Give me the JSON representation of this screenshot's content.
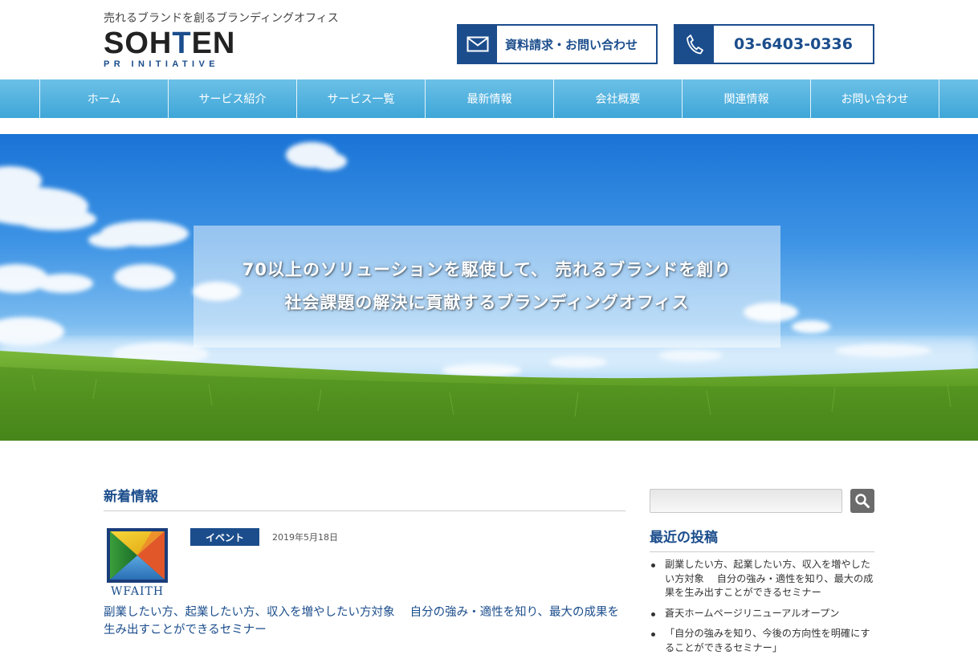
{
  "header": {
    "tagline": "売れるブランドを創るブランディングオフィス",
    "logo_main_a": "SOH",
    "logo_main_b": "T",
    "logo_main_c": "EN",
    "logo_sub": "PR INITIATIVE",
    "contact_label": "資料請求・お問い合わせ",
    "phone": "03-6403-0336",
    "brand_color": "#1b4d8c"
  },
  "nav": {
    "items": [
      "ホーム",
      "サービス紹介",
      "サービス一覧",
      "最新情報",
      "会社概要",
      "関連情報",
      "お問い合わせ"
    ]
  },
  "hero": {
    "line1": "70以上のソリューションを駆使して、 売れるブランドを創り",
    "line2": "社会課題の解決に貢献するブランディングオフィス"
  },
  "news": {
    "title": "新着情報",
    "post": {
      "thumb_text": "WFAITH",
      "category": "イベント",
      "date": "2019年5月18日",
      "title": "副業したい方、起業したい方、収入を増やしたい方対象　 自分の強み・適性を知り、最大の成果を生み出すことができるセミナー"
    }
  },
  "sidebar": {
    "search": {
      "placeholder": "",
      "icon": "search-icon"
    },
    "recent_title": "最近の投稿",
    "recent_posts": [
      "副業したい方、起業したい方、収入を増やしたい方対象　 自分の強み・適性を知り、最大の成果を生み出すことができるセミナー",
      "蒼天ホームページリニューアルオープン",
      "「自分の強みを知り、今後の方向性を明確にすることができるセミナー」"
    ]
  }
}
